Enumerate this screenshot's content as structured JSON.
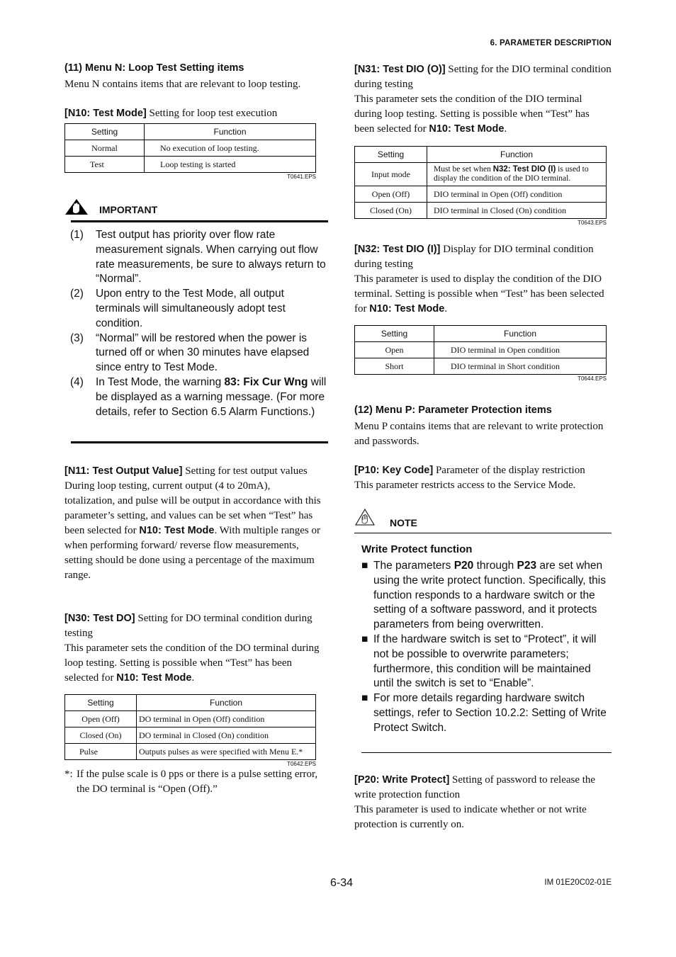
{
  "header": {
    "section": "6.  PARAMETER DESCRIPTION"
  },
  "left": {
    "menu_n_heading": "(11) Menu N: Loop Test Setting items",
    "menu_n_desc": "Menu N contains items that are relevant to loop testing.",
    "n10": {
      "term": "[N10: Test Mode]",
      "title": " Setting for loop test execution",
      "table": {
        "headers": [
          "Setting",
          "Function"
        ],
        "rows": [
          [
            "Normal",
            "No execution of loop testing."
          ],
          [
            "Test",
            "Loop testing is started"
          ]
        ],
        "ref": "T0641.EPS"
      }
    },
    "important": {
      "label": "IMPORTANT",
      "items": [
        {
          "num": "(1)",
          "text": "Test output has priority over flow rate measurement signals. When carrying out flow rate measurements, be sure to always return to “Normal”."
        },
        {
          "num": "(2)",
          "text": "Upon entry to the Test Mode, all output terminals will simultaneously adopt test condition."
        },
        {
          "num": "(3)",
          "text": "“Normal” will be restored when the power is turned off or when 30 minutes have elapsed since entry to Test Mode."
        },
        {
          "num": "(4)",
          "pre": "In Test Mode, the warning ",
          "bold": "83: Fix Cur Wng",
          "post": " will be displayed as a warning message. (For more details, refer to Section 6.5 Alarm Functions.)"
        }
      ]
    },
    "n11": {
      "term": "[N11: Test Output Value]",
      "title": " Setting for test output values",
      "body_pre": "During loop testing, current output (4 to 20mA), totalization, and pulse will be output in accordance with this parameter’s setting, and values can be set when “Test” has been selected for ",
      "body_bold": "N10: Test Mode",
      "body_post": ". With multiple ranges or when performing forward/ reverse flow measurements, setting should be done using a percentage of the maximum range."
    },
    "n30": {
      "term": "[N30: Test DO]",
      "title": " Setting for DO terminal condition during testing",
      "body_pre": "This parameter sets the condition of the DO terminal during loop testing.  Setting is possible when “Test” has been selected for ",
      "body_bold": "N10: Test Mode",
      "body_post": ".",
      "table": {
        "headers": [
          "Setting",
          "Function"
        ],
        "rows": [
          [
            "Open (Off)",
            "DO terminal in Open (Off) condition"
          ],
          [
            "Closed (On)",
            "DO terminal in Closed (On) condition"
          ],
          [
            "Pulse",
            "Outputs pulses as were specified with Menu E.*"
          ]
        ],
        "ref": "T0642.EPS"
      },
      "footnote_mark": "*:",
      "footnote": "If the pulse scale is 0 pps or there is a pulse setting error, the DO terminal is “Open (Off).”"
    }
  },
  "right": {
    "n31": {
      "term": "[N31: Test DIO (O)]",
      "title": " Setting for the DIO terminal condition during testing",
      "body_pre": "This parameter sets the condition of the DIO terminal during loop testing.  Setting is possible when “Test” has been selected for ",
      "body_bold": "N10: Test Mode",
      "body_post": ".",
      "table": {
        "headers": [
          "Setting",
          "Function"
        ],
        "rows": [
          {
            "setting": "Input mode",
            "pre": "Must be set when ",
            "bold": "N32: Test DIO (I)",
            "post": " is used to display the condition of the DIO terminal."
          },
          {
            "setting": "Open (Off)",
            "pre": "DIO terminal in Open (Off) condition"
          },
          {
            "setting": "Closed (On)",
            "pre": "DIO terminal in Closed (On) condition"
          }
        ],
        "ref": "T0643.EPS"
      }
    },
    "n32": {
      "term": "[N32: Test DIO (I)]",
      "title": " Display for DIO terminal condition during testing",
      "body_pre": "This parameter is used to display the condition of the DIO terminal.  Setting is possible when “Test” has been selected for ",
      "body_bold": "N10: Test Mode",
      "body_post": ".",
      "table": {
        "headers": [
          "Setting",
          "Function"
        ],
        "rows": [
          [
            "Open",
            "DIO terminal in Open condition"
          ],
          [
            "Short",
            "DIO terminal in Short condition"
          ]
        ],
        "ref": "T0644.EPS"
      }
    },
    "menu_p_heading": "(12) Menu P: Parameter Protection items",
    "menu_p_desc": "Menu P contains items that are relevant to write protection and passwords.",
    "p10": {
      "term": "[P10: Key Code]",
      "title": " Parameter of the display restriction",
      "body": "This parameter restricts access to the Service Mode."
    },
    "note": {
      "label": "NOTE",
      "heading": "Write Protect function",
      "bullet": "■",
      "items": [
        {
          "segs": [
            [
              "The parameters ",
              false
            ],
            [
              "P20",
              true
            ],
            [
              " through ",
              false
            ],
            [
              "P23",
              true
            ],
            [
              " are set when using the write protect function. Specifically, this function responds to a hardware switch or the setting of a software password, and it protects parameters from being overwritten.",
              false
            ]
          ]
        },
        {
          "segs": [
            [
              "If the hardware switch is set to “Protect”, it will not be possible to overwrite parameters; furthermore, this condition will be maintained until the switch is set to “Enable”.",
              false
            ]
          ]
        },
        {
          "segs": [
            [
              "For more details regarding hardware switch settings, refer to Section 10.2.2: Setting of Write Protect Switch.",
              false
            ]
          ]
        }
      ]
    },
    "p20": {
      "term": "[P20: Write Protect]",
      "title": " Setting of password to release the write protection function",
      "body": "This parameter is used to indicate whether or not write protection is currently on."
    }
  },
  "footer": {
    "page": "6-34",
    "doc_id": "IM 01E20C02-01E"
  }
}
